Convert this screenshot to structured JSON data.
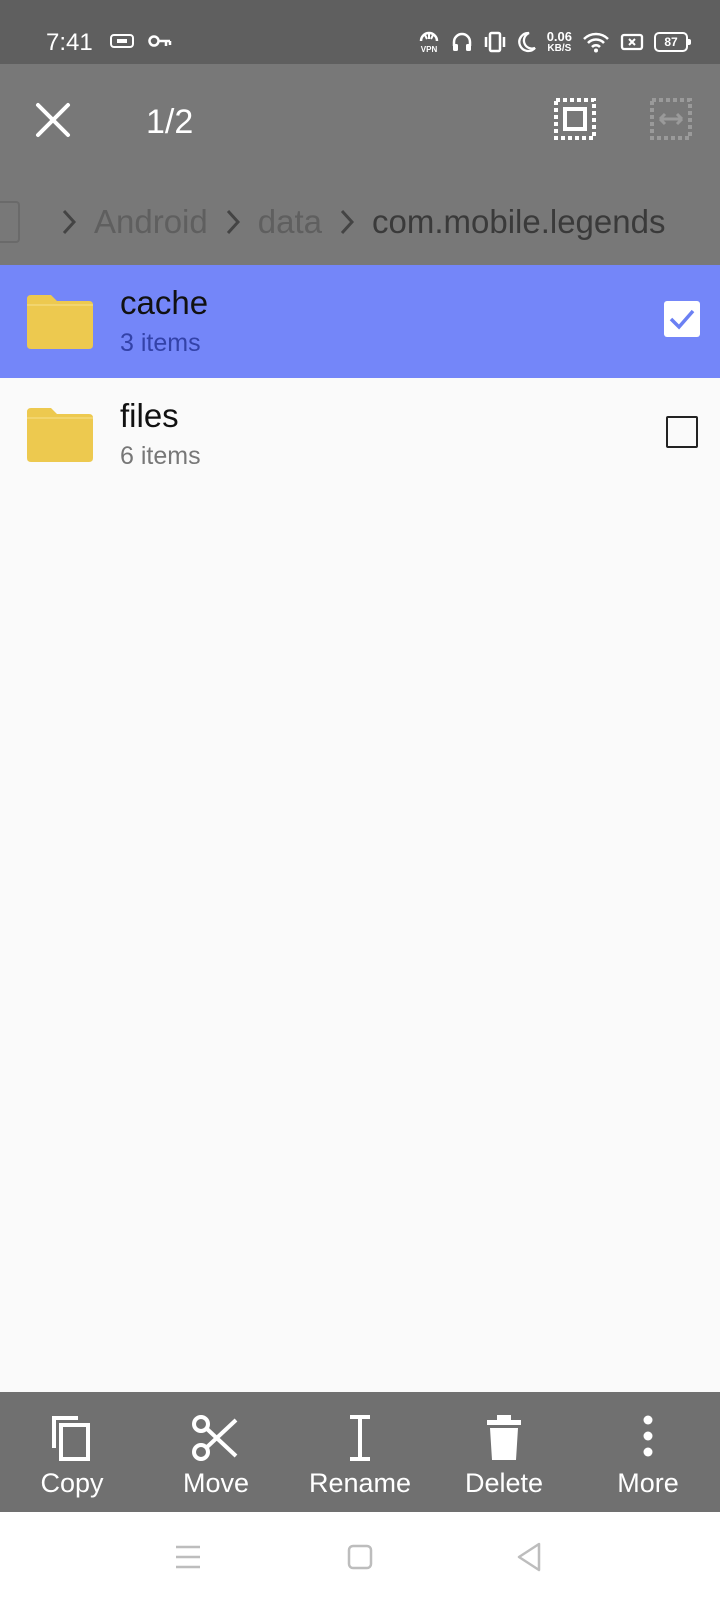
{
  "status_bar": {
    "time": "7:41",
    "net_speed_value": "0.06",
    "net_speed_unit": "KB/S",
    "vpn_label": "VPN",
    "battery": "87",
    "icons": [
      "sim-icon",
      "key-icon",
      "vpn-icon",
      "headphones-icon",
      "vibrate-icon",
      "moon-icon",
      "wifi-icon",
      "no-sim-icon",
      "battery-icon"
    ]
  },
  "toolbar": {
    "selection_count": "1/2",
    "icons": [
      "close-icon",
      "select-all-icon",
      "select-range-icon"
    ]
  },
  "breadcrumb": {
    "items": [
      "Android",
      "data",
      "com.mobile.legends"
    ]
  },
  "files": [
    {
      "name": "cache",
      "meta": "3 items",
      "selected": true
    },
    {
      "name": "files",
      "meta": "6 items",
      "selected": false
    }
  ],
  "actions": [
    {
      "label": "Copy",
      "icon": "copy-icon"
    },
    {
      "label": "Move",
      "icon": "scissors-icon"
    },
    {
      "label": "Rename",
      "icon": "text-cursor-icon"
    },
    {
      "label": "Delete",
      "icon": "trash-icon"
    },
    {
      "label": "More",
      "icon": "more-vertical-icon"
    }
  ],
  "colors": {
    "selected_row": "#7486f9",
    "folder": "#edc94f",
    "toolbar": "#787878",
    "bottom_bar": "#707070"
  }
}
